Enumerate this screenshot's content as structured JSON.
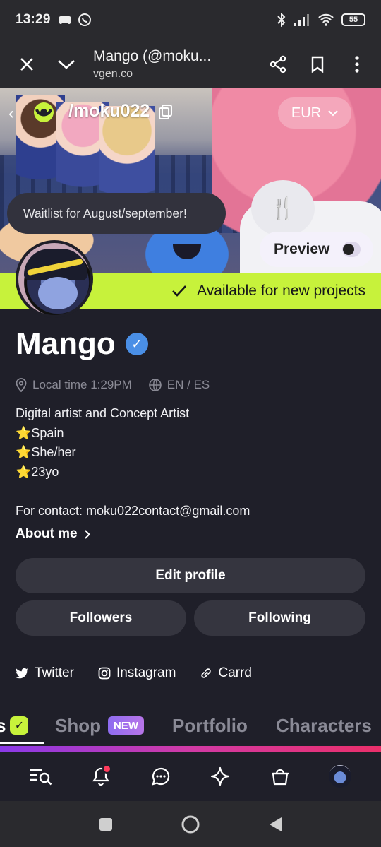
{
  "status_bar": {
    "time": "13:29",
    "battery": "55"
  },
  "browser": {
    "title": "Mango (@moku...",
    "url": "vgen.co"
  },
  "profile": {
    "handle": "/moku022",
    "currency": "EUR",
    "status_note": "Waitlist for August/september!",
    "preview_label": "Preview",
    "availability": "Available for new projects",
    "name": "Mango",
    "local_time": "Local time 1:29PM",
    "languages": "EN / ES",
    "bio": [
      "Digital artist and Concept Artist",
      "⭐Spain",
      "⭐She/her",
      "⭐23yo",
      "",
      "For contact: moku022contact@gmail.com"
    ],
    "about_label": "About me"
  },
  "buttons": {
    "edit": "Edit profile",
    "followers": "Followers",
    "following": "Following"
  },
  "socials": [
    {
      "label": "Twitter"
    },
    {
      "label": "Instagram"
    },
    {
      "label": "Carrd"
    }
  ],
  "tabs": {
    "first": "s",
    "shop": "Shop",
    "shop_badge": "NEW",
    "portfolio": "Portfolio",
    "characters": "Characters"
  },
  "colors": {
    "accent_lime": "#c7f23b",
    "verified_blue": "#4a8fe6",
    "bg": "#1f1f29"
  }
}
